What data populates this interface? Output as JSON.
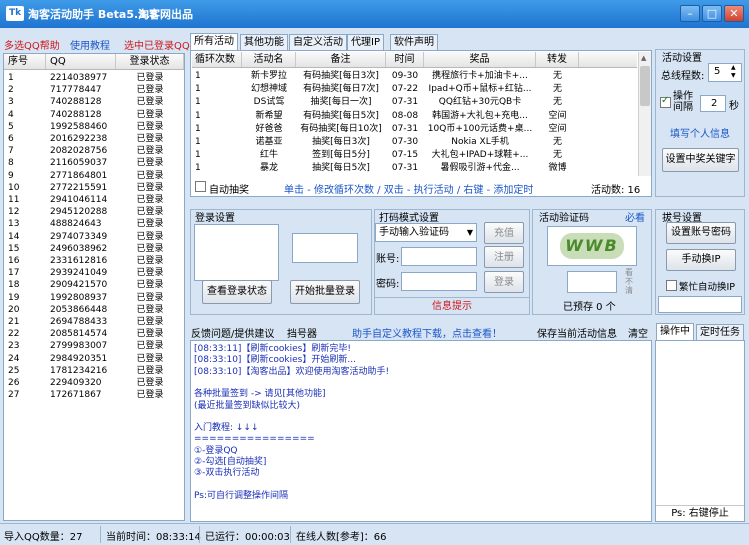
{
  "window": {
    "logo": "Tk",
    "title": "淘客活动助手 Beta5.3.5",
    "site": "淘客网出品",
    "min": "–",
    "max": "□",
    "close": "✕"
  },
  "left_links": {
    "help": "多选QQ帮助",
    "tutorial": "使用教程",
    "selected": "选中已登录QQ"
  },
  "qq_table": {
    "headers": [
      "序号",
      "QQ",
      "登录状态"
    ],
    "rows": [
      [
        "1",
        "2214038977",
        "已登录"
      ],
      [
        "2",
        "717778447",
        "已登录"
      ],
      [
        "3",
        "740288128",
        "已登录"
      ],
      [
        "4",
        "740288128",
        "已登录"
      ],
      [
        "5",
        "1992588460",
        "已登录"
      ],
      [
        "6",
        "2016292238",
        "已登录"
      ],
      [
        "7",
        "2082028756",
        "已登录"
      ],
      [
        "8",
        "2116059037",
        "已登录"
      ],
      [
        "9",
        "2771864801",
        "已登录"
      ],
      [
        "10",
        "2772215591",
        "已登录"
      ],
      [
        "11",
        "2941046114",
        "已登录"
      ],
      [
        "12",
        "2945120288",
        "已登录"
      ],
      [
        "13",
        "488824643",
        "已登录"
      ],
      [
        "14",
        "2974073349",
        "已登录"
      ],
      [
        "15",
        "2496038962",
        "已登录"
      ],
      [
        "16",
        "2331612816",
        "已登录"
      ],
      [
        "17",
        "2939241049",
        "已登录"
      ],
      [
        "18",
        "2909421570",
        "已登录"
      ],
      [
        "19",
        "1992808937",
        "已登录"
      ],
      [
        "20",
        "2053866448",
        "已登录"
      ],
      [
        "21",
        "2694788433",
        "已登录"
      ],
      [
        "22",
        "2085814574",
        "已登录"
      ],
      [
        "23",
        "2799983007",
        "已登录"
      ],
      [
        "24",
        "2984920351",
        "已登录"
      ],
      [
        "25",
        "1781234216",
        "已登录"
      ],
      [
        "26",
        "229409320",
        "已登录"
      ],
      [
        "27",
        "172671867",
        "已登录"
      ]
    ]
  },
  "tabs": [
    "所有活动",
    "其他功能",
    "自定义活动",
    "代理IP",
    "软件声明"
  ],
  "activity_table": {
    "headers": [
      "循环次数",
      "活动名",
      "备注",
      "时间",
      "奖品",
      "转发"
    ],
    "rows": [
      [
        "1",
        "新卡罗拉",
        "有码抽奖[每日3次]",
        "09-30",
        "携程旅行卡+加油卡+...",
        "无"
      ],
      [
        "1",
        "幻想神域",
        "有码抽奖[每日7次]",
        "07-22",
        "Ipad+Q币+鼠标+红钻...",
        "无"
      ],
      [
        "1",
        "DS试驾",
        "抽奖[每日一次]",
        "07-31",
        "QQ红钻+30元QB卡",
        "无"
      ],
      [
        "1",
        "新希望",
        "有码抽奖[每日5次]",
        "08-08",
        "韩国游+大礼包+充电...",
        "空间"
      ],
      [
        "1",
        "好爸爸",
        "有码抽奖[每日10次]",
        "07-31",
        "10Q币+100元话费+桌...",
        "空间"
      ],
      [
        "1",
        "诺基亚",
        "抽奖[每日3次]",
        "07-30",
        "Nokia XL手机",
        "无"
      ],
      [
        "1",
        "红牛",
        "签到[每日5分]",
        "07-15",
        "大礼包+IPAD+球鞋+...",
        "无"
      ],
      [
        "1",
        "暴龙",
        "抽奖[每日5次]",
        "07-31",
        "暑假吸引游+代金...",
        "微博"
      ]
    ]
  },
  "auto_draw": "自动抽奖",
  "activity_hint": "单击 - 修改循环次数 / 双击 - 执行活动 / 右键 - 添加定时",
  "activity_count_label": "活动数: 16",
  "login_settings": {
    "title": "登录设置",
    "check_btn": "查看登录状态",
    "batch_btn": "开始批量登录"
  },
  "captcha": {
    "title": "打码模式设置",
    "mode": "手动输入验证码",
    "recharge": "充值",
    "register": "注册",
    "login": "登录",
    "account_label": "账号:",
    "password_label": "密码:",
    "info": "信息提示"
  },
  "verify": {
    "title": "活动验证码",
    "required": "必看",
    "captcha_text": "WWB",
    "refresh": "看不清",
    "preloaded": "已预存 0 个"
  },
  "settings": {
    "title": "活动设置",
    "total_label": "总线程数:",
    "total_value": "5",
    "interval_label": "操作间隔",
    "interval_value": "2",
    "interval_unit": "秒",
    "fill_info": "填写个人信息",
    "set_keyword": "设置中奖关键字"
  },
  "dial": {
    "title": "拔号设置",
    "set_account": "设置账号密码",
    "manual_ip": "手动换IP",
    "busy_auto": "繁忙自动换IP"
  },
  "log_toolbar": {
    "feedback": "反馈问题/提供建议",
    "probe": "挡号器",
    "custom_download": "助手自定义教程下载，点击查看！",
    "save_info": "保存当前活动信息",
    "clear": "清空"
  },
  "log_lines": [
    "[08:33:11]【刷新cookies】刷新完毕!",
    "[08:33:10]【刷新cookies】开始刷新...",
    "[08:33:10]【淘客出品】欢迎使用淘客活动助手!",
    "",
    "各种批量签到 -> 请见[其他功能]",
    "(最近批量签到缺似比较大)",
    "",
    "入门教程: ↓↓↓",
    "================",
    "①-登录QQ",
    "②-勾选[自动抽奖]",
    "③-双击执行活动",
    "",
    "Ps:可自行调整操作间隔"
  ],
  "op_tabs": [
    "操作中",
    "定时任务"
  ],
  "op_hint": "Ps: 右键停止",
  "status": {
    "imported": "导入QQ数量：27",
    "time": "当前时间：08:33:14",
    "runtime": "已运行：00:00:03",
    "online": "在线人数[参考]：66"
  },
  "colors": {
    "titlebar": "#1f74d0",
    "link_red": "#d01818",
    "link_blue": "#1a56c8",
    "info_red": "#d01818"
  }
}
